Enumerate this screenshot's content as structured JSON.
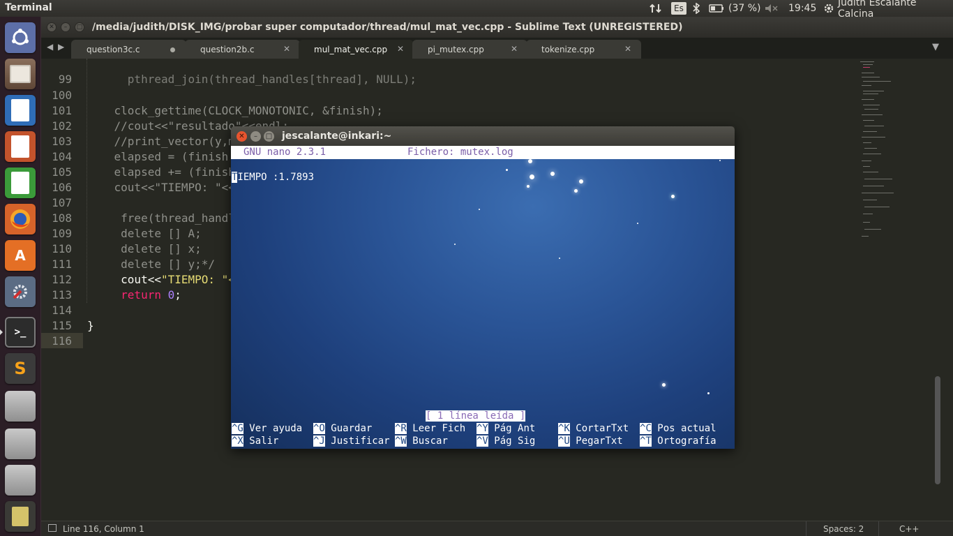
{
  "top_panel": {
    "app_name": "Terminal",
    "keyboard_layout": "Es",
    "battery": "(37 %)",
    "time": "19:45",
    "user": "Judith Escalante Calcina"
  },
  "launcher": {
    "items": [
      {
        "name": "dash",
        "icon": "ubuntu-logo-icon"
      },
      {
        "name": "files",
        "icon": "file-cabinet-icon"
      },
      {
        "name": "writer",
        "icon": "document-icon"
      },
      {
        "name": "impress",
        "icon": "presentation-icon"
      },
      {
        "name": "calc",
        "icon": "spreadsheet-icon"
      },
      {
        "name": "firefox",
        "icon": "firefox-icon"
      },
      {
        "name": "software-center",
        "icon": "shopping-bag-icon"
      },
      {
        "name": "system-settings",
        "icon": "settings-icon"
      },
      {
        "name": "terminal",
        "icon": "terminal-icon"
      },
      {
        "name": "sublime-text",
        "icon": "sublime-icon"
      },
      {
        "name": "drive-1",
        "icon": "drive-icon"
      },
      {
        "name": "drive-2",
        "icon": "drive-icon"
      },
      {
        "name": "drive-3",
        "icon": "drive-icon"
      },
      {
        "name": "trash",
        "icon": "trash-icon"
      }
    ]
  },
  "sublime": {
    "title": "/media/judith/DISK_IMG/probar super computador/thread/mul_mat_vec.cpp - Sublime Text (UNREGISTERED)",
    "tabs": [
      {
        "label": "question3c.c",
        "state": "modified"
      },
      {
        "label": "question2b.c",
        "state": "saved"
      },
      {
        "label": "mul_mat_vec.cpp",
        "state": "active"
      },
      {
        "label": "pi_mutex.cpp",
        "state": "saved"
      },
      {
        "label": "tokenize.cpp",
        "state": "saved"
      }
    ],
    "line_numbers": [
      "99",
      "100",
      "101",
      "102",
      "103",
      "104",
      "105",
      "106",
      "107",
      "108",
      "109",
      "110",
      "111",
      "112",
      "113",
      "114",
      "115",
      "116"
    ],
    "code": {
      "l99": "      pthread_join(thread_handles[thread], NULL);",
      "l101": "    clock_gettime(CLOCK_MONOTONIC, &finish);",
      "l102": "    //cout<<\"resultado\"<<endl;",
      "l103": "    //print_vector(y,m);",
      "l104": "    elapsed = (finish.",
      "l105": "    elapsed += (finish",
      "l106": "    cout<<\"TIEMPO: \"<<",
      "l108": "     free(thread_handl",
      "l109": "     delete [] A;",
      "l110": "     delete [] x;",
      "l111": "     delete [] y;*/",
      "l112_a": "     cout<<",
      "l112_b": "\"TIEMPO: \"<",
      "l113_a": "     return ",
      "l113_b": "0",
      "l113_c": ";",
      "l115": "}"
    },
    "status_left": "Line 116, Column 1",
    "status_spaces": "Spaces: 2",
    "status_syntax": "C++"
  },
  "terminal": {
    "title": "jescalante@inkari:~",
    "nano_version": "GNU nano 2.3.1",
    "nano_file": "Fichero: mutex.log",
    "content_cursor_char": "T",
    "content_rest": "IEMPO :1.7893",
    "status_message": "[ 1 línea leída ]",
    "shortcuts": [
      {
        "key": "^G",
        "label": "Ver ayuda"
      },
      {
        "key": "^O",
        "label": "Guardar"
      },
      {
        "key": "^R",
        "label": "Leer Fich"
      },
      {
        "key": "^Y",
        "label": "Pág Ant"
      },
      {
        "key": "^K",
        "label": "CortarTxt"
      },
      {
        "key": "^C",
        "label": "Pos actual"
      },
      {
        "key": "^X",
        "label": "Salir"
      },
      {
        "key": "^J",
        "label": "Justificar"
      },
      {
        "key": "^W",
        "label": "Buscar"
      },
      {
        "key": "^V",
        "label": "Pág Sig"
      },
      {
        "key": "^U",
        "label": "PegarTxt"
      },
      {
        "key": "^T",
        "label": "Ortografía"
      }
    ]
  }
}
